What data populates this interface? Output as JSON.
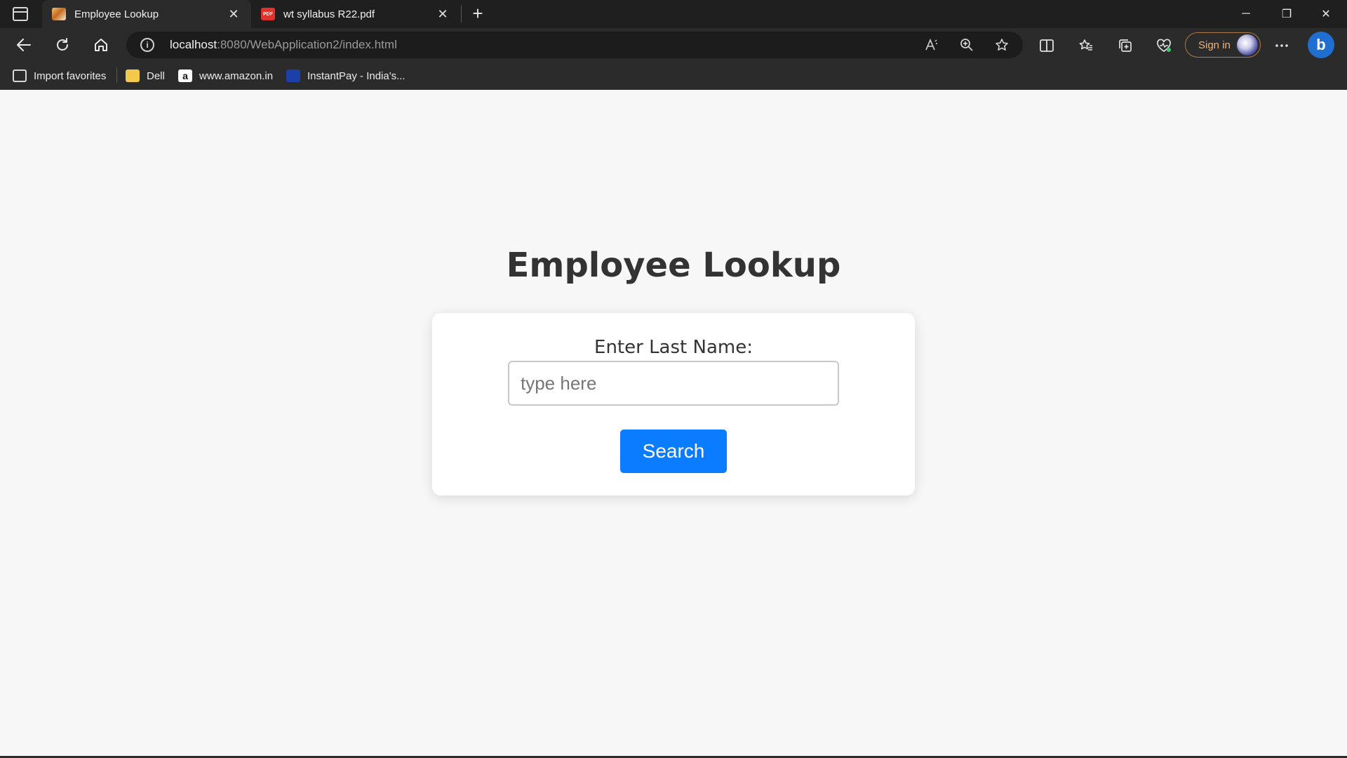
{
  "browser": {
    "tabs": [
      {
        "title": "Employee Lookup",
        "icon": "page-favicon",
        "active": true
      },
      {
        "title": "wt syllabus R22.pdf",
        "icon": "pdf-favicon",
        "active": false
      }
    ],
    "tab_close_glyph": "✕",
    "new_tab_glyph": "+",
    "window_controls": {
      "minimize": "─",
      "restore": "❐",
      "close": "✕"
    },
    "address": {
      "host": "localhost",
      "rest": ":8080/WebApplication2/index.html"
    },
    "sign_in_label": "Sign in",
    "favorites": [
      {
        "label": "Import favorites",
        "icon": "import-favorites-icon"
      },
      {
        "label": "Dell",
        "icon": "folder-icon"
      },
      {
        "label": "www.amazon.in",
        "icon": "amazon-icon"
      },
      {
        "label": "InstantPay - India's...",
        "icon": "instantpay-icon"
      }
    ],
    "amazon_glyph": "a",
    "pdf_glyph": "PDF",
    "bing_glyph": "b",
    "accent_color": "#0a7cff"
  },
  "page": {
    "title": "Employee Lookup",
    "label": "Enter Last Name:",
    "input_value": "",
    "input_placeholder": "type here",
    "search_label": "Search"
  }
}
